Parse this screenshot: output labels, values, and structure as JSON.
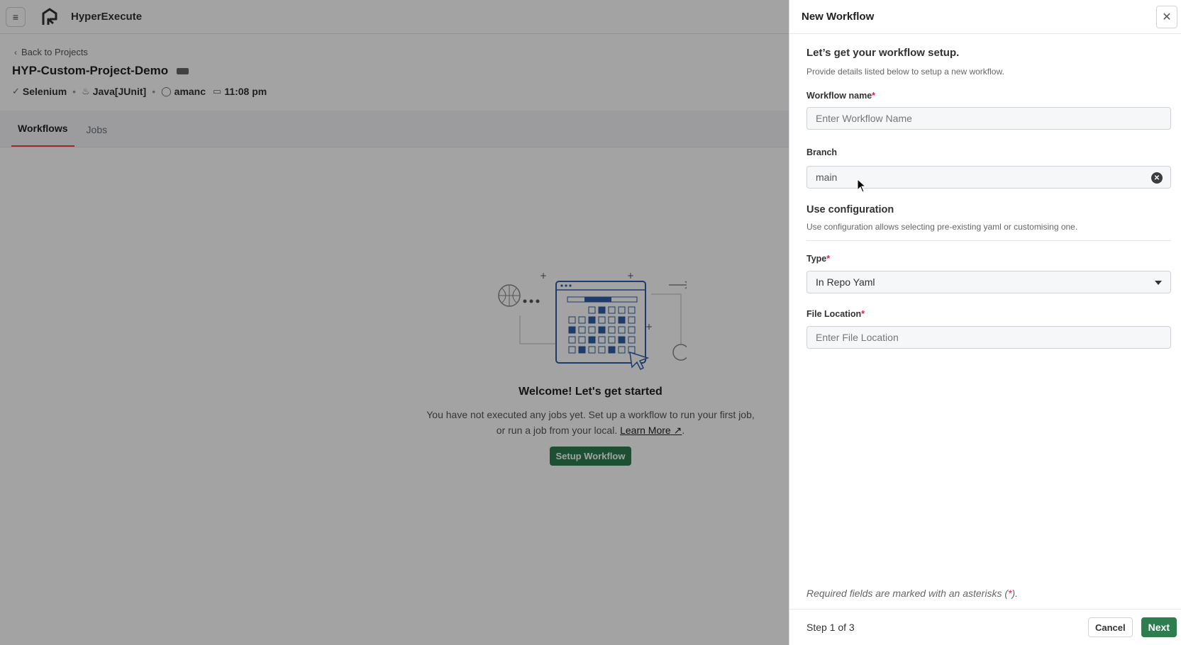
{
  "app": {
    "brand": "HyperExecute",
    "back_label": "Back to Projects",
    "project_title": "HYP-Custom-Project-Demo",
    "meta": {
      "framework": "Selenium",
      "language": "Java[JUnit]",
      "user": "amanc",
      "time": "11:08 pm"
    },
    "tabs": [
      "Workflows",
      "Jobs"
    ],
    "empty": {
      "title": "Welcome! Let's get started",
      "line1": "You have not executed any jobs yet. Set up a workflow to run your first job,",
      "line2_prefix": "or run a job from your local.",
      "learn_more": "Learn More",
      "line2_suffix": ".",
      "button": "Setup Workflow"
    }
  },
  "drawer": {
    "title": "New Workflow",
    "heading": "Let’s get your workflow setup.",
    "subheading": "Provide details listed below to setup a new workflow.",
    "workflow_name": {
      "label": "Workflow name",
      "placeholder": "Enter Workflow Name",
      "value": ""
    },
    "branch": {
      "label": "Branch",
      "value": "main"
    },
    "config": {
      "heading": "Use configuration",
      "description": "Use configuration allows selecting pre-existing yaml or customising one."
    },
    "type": {
      "label": "Type",
      "value": "In Repo Yaml"
    },
    "file_location": {
      "label": "File Location",
      "placeholder": "Enter File Location",
      "value": ""
    },
    "required_note_prefix": "Required fields are marked with an asterisks (",
    "required_note_star": "*",
    "required_note_suffix": ").",
    "step": "Step 1 of 3",
    "cancel": "Cancel",
    "next": "Next"
  },
  "colors": {
    "accent_green": "#2e7d4f",
    "required_red": "#e11d48",
    "active_tab_underline": "#ef4444",
    "illustration_blue": "#2f5ea8"
  },
  "icons": {
    "menu": "hamburger-icon",
    "close": "close-icon",
    "clear": "clear-circle-icon",
    "dropdown": "caret-down-icon",
    "external": "external-link-icon"
  }
}
